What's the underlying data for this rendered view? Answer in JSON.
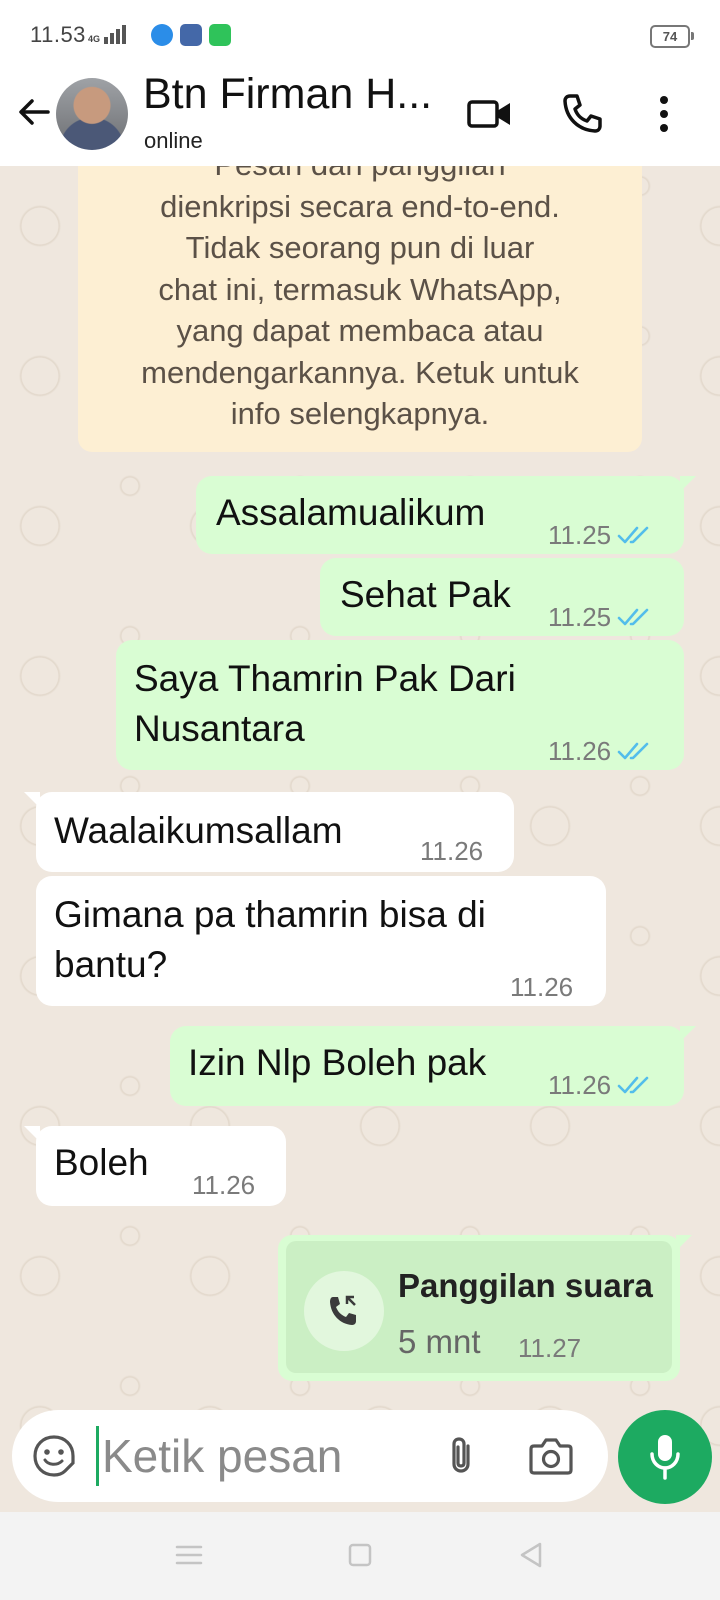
{
  "status_bar": {
    "time": "11.53",
    "network": "4G",
    "battery": "74"
  },
  "header": {
    "contact_name": "Btn Firman H...",
    "status": "online"
  },
  "system_notice": "Pesan dan panggilan\ndienkripsi secara end-to-end.\nTidak seorang pun di luar\nchat ini, termasuk WhatsApp,\nyang dapat membaca atau\nmendengarkannya. Ketuk untuk\ninfo selengkapnya.",
  "messages": [
    {
      "direction": "out",
      "text": "Assalamualikum",
      "time": "11.25",
      "status": "read"
    },
    {
      "direction": "out",
      "text": "Sehat Pak",
      "time": "11.25",
      "status": "read"
    },
    {
      "direction": "out",
      "text": "Saya Thamrin Pak Dari\nNusantara",
      "time": "11.26",
      "status": "read"
    },
    {
      "direction": "in",
      "text": "Waalaikumsallam",
      "time": "11.26"
    },
    {
      "direction": "in",
      "text": "Gimana pa thamrin bisa di\nbantu?",
      "time": "11.26"
    },
    {
      "direction": "out",
      "text": "Izin Nlp Boleh pak",
      "time": "11.26",
      "status": "read"
    },
    {
      "direction": "in",
      "text": "Boleh",
      "time": "11.26"
    }
  ],
  "call": {
    "title": "Panggilan suara",
    "duration": "5 mnt",
    "time": "11.27"
  },
  "composer": {
    "placeholder": "Ketik pesan"
  },
  "colors": {
    "accent": "#1daa61",
    "outgoing": "#d9fdd3",
    "incoming": "#ffffff",
    "read_ticks": "#53bdeb"
  }
}
